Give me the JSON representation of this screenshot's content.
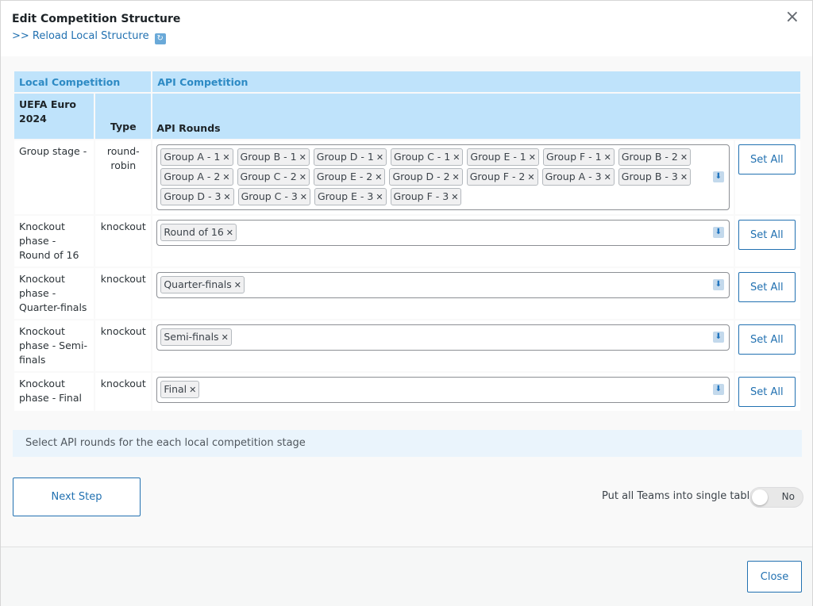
{
  "dialog": {
    "title": "Edit Competition Structure",
    "reload_label": ">> Reload Local Structure",
    "close_icon": "×"
  },
  "table": {
    "header_local": "Local Competition",
    "header_api": "API Competition",
    "local_name": "UEFA Euro 2024",
    "col_type": "Type",
    "col_api_rounds": "API Rounds",
    "rows": [
      {
        "stage": "Group stage -",
        "type": "round-robin",
        "rounds": [
          "Group A - 1",
          "Group B - 1",
          "Group D - 1",
          "Group C - 1",
          "Group E - 1",
          "Group F - 1",
          "Group B - 2",
          "Group A - 2",
          "Group C - 2",
          "Group E - 2",
          "Group D - 2",
          "Group F - 2",
          "Group A - 3",
          "Group B - 3",
          "Group D - 3",
          "Group C - 3",
          "Group E - 3",
          "Group F - 3"
        ]
      },
      {
        "stage": "Knockout phase - Round of 16",
        "type": "knockout",
        "rounds": [
          "Round of 16"
        ]
      },
      {
        "stage": "Knockout phase - Quarter-finals",
        "type": "knockout",
        "rounds": [
          "Quarter-finals"
        ]
      },
      {
        "stage": "Knockout phase - Semi-finals",
        "type": "knockout",
        "rounds": [
          "Semi-finals"
        ]
      },
      {
        "stage": "Knockout phase - Final",
        "type": "knockout",
        "rounds": [
          "Final"
        ]
      }
    ],
    "set_all_label": "Set All",
    "dropdown_icon": "⬇"
  },
  "info_message": "Select API rounds for the each local competition stage",
  "next_step_label": "Next Step",
  "toggle": {
    "label": "Put all Teams into single table",
    "state": "No"
  },
  "close_label": "Close",
  "colors": {
    "accent": "#2271b1",
    "header_bg": "#bfe3fb",
    "info_bg": "#eaf4fc"
  }
}
